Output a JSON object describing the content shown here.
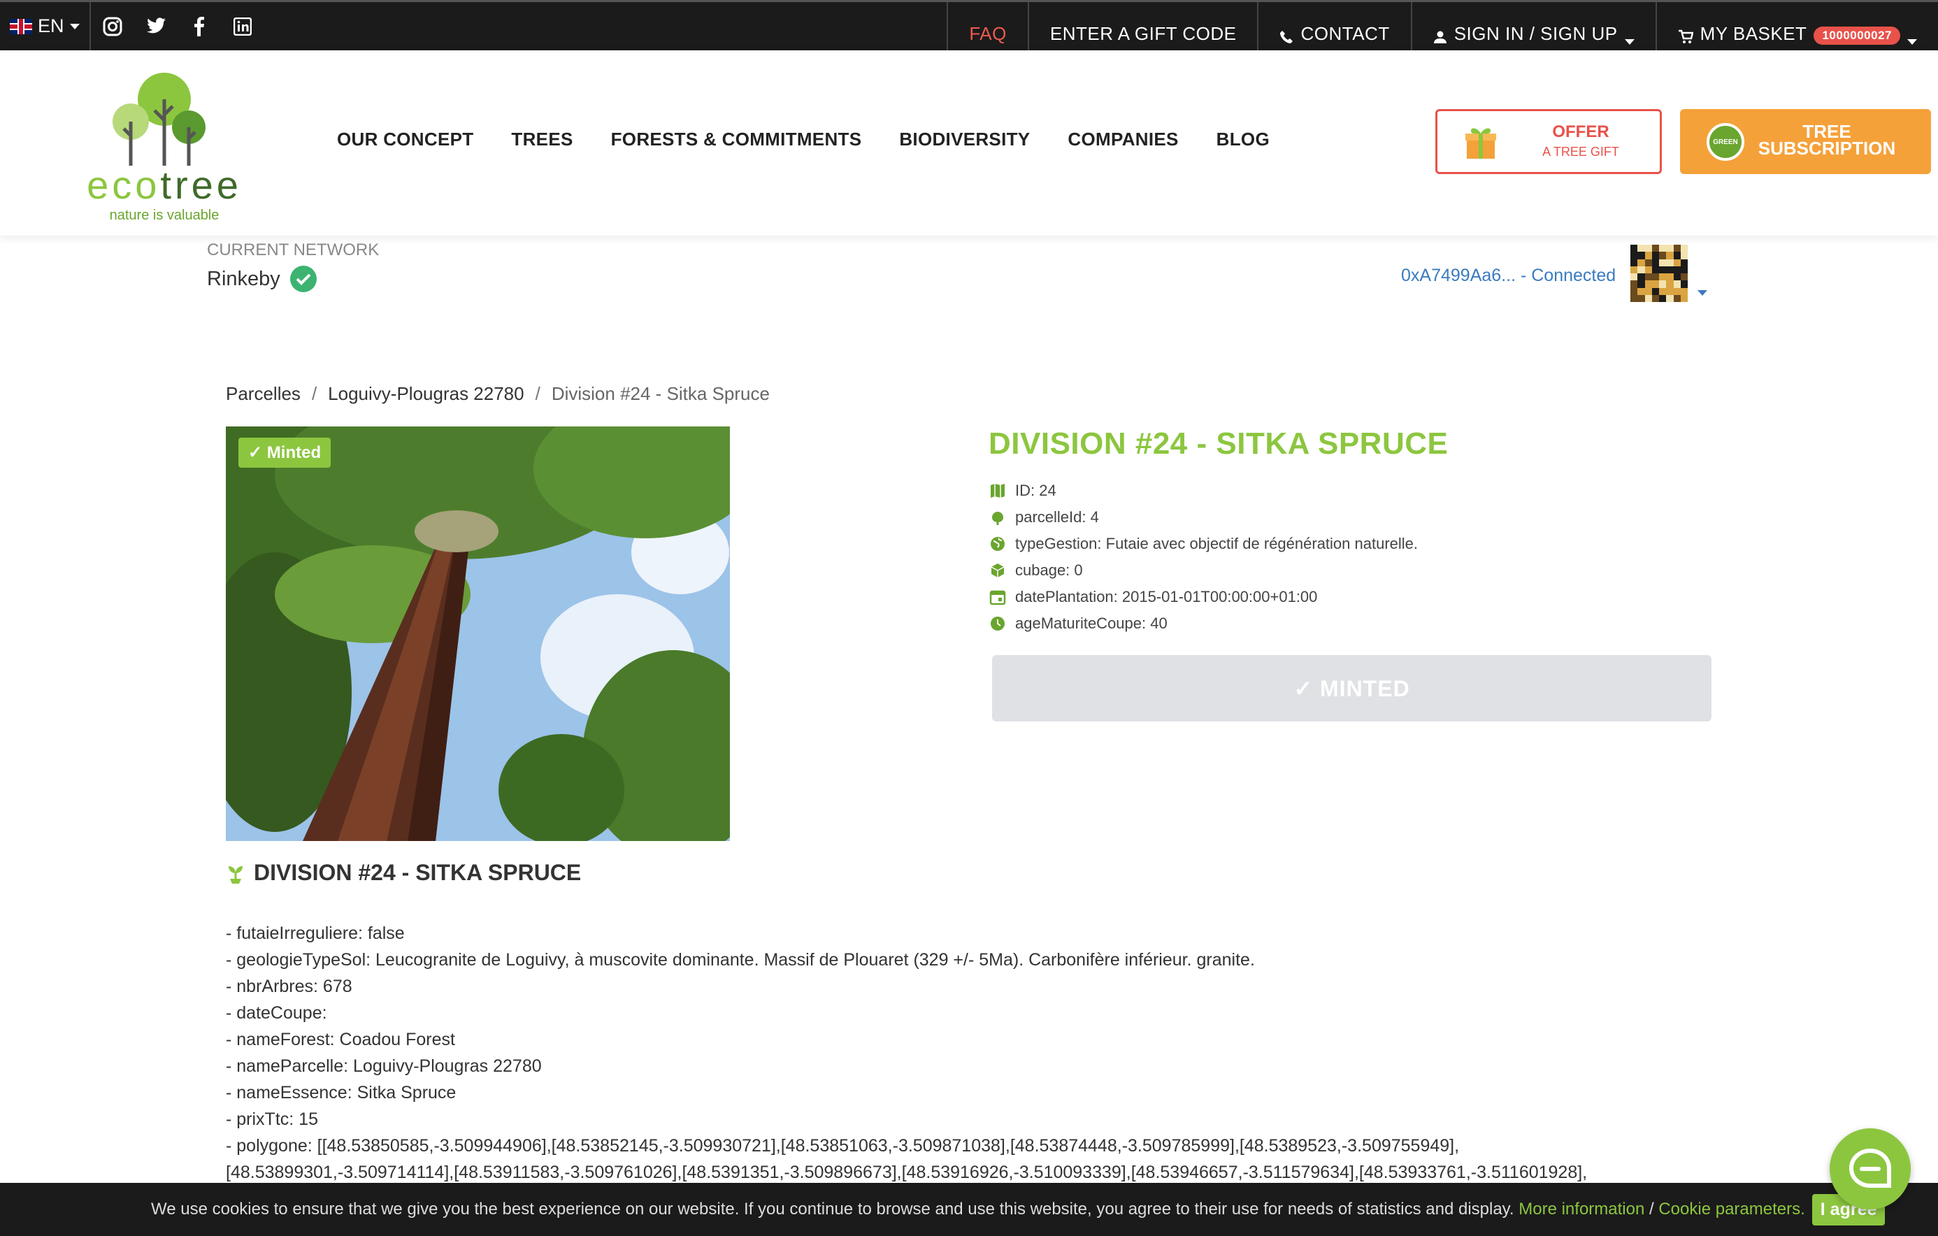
{
  "topbar": {
    "language": "EN",
    "faq": "FAQ",
    "gift_code": "ENTER A GIFT CODE",
    "contact": "CONTACT",
    "sign_in": "SIGN IN / SIGN UP",
    "basket": "MY BASKET",
    "basket_count": "1000000027"
  },
  "logo": {
    "word_light": "eco",
    "word_dark": "tree",
    "tagline": "nature is valuable"
  },
  "nav": {
    "items": [
      "OUR CONCEPT",
      "TREES",
      "FORESTS & COMMITMENTS",
      "BIODIVERSITY",
      "COMPANIES",
      "BLOG"
    ]
  },
  "cta": {
    "offer_line1": "OFFER",
    "offer_line2": "A TREE GIFT",
    "sub_line1": "TREE",
    "sub_line2": "SUBSCRIPTION",
    "sub_badge": "GREEN"
  },
  "network": {
    "label": "CURRENT NETWORK",
    "value": "Rinkeby"
  },
  "wallet": {
    "text": "0xA7499Aa6... - Connected"
  },
  "breadcrumb": [
    "Parcelles",
    "Loguivy-Plougras 22780",
    "Division #24 - Sitka Spruce"
  ],
  "product": {
    "badge": "Minted",
    "title": "DIVISION #24 - SITKA SPRUCE",
    "props": [
      {
        "icon": "map-icon",
        "text": "ID: 24"
      },
      {
        "icon": "leaf-icon",
        "text": "parcelleId: 4"
      },
      {
        "icon": "globe-icon",
        "text": "typeGestion: Futaie avec objectif de régénération naturelle."
      },
      {
        "icon": "cube-icon",
        "text": "cubage: 0"
      },
      {
        "icon": "calendar-icon",
        "text": "datePlantation: 2015-01-01T00:00:00+01:00"
      },
      {
        "icon": "clock-icon",
        "text": "ageMaturiteCoupe: 40"
      }
    ],
    "minted_button": "✓ MINTED",
    "subtitle": "DIVISION #24 - SITKA SPRUCE",
    "description": [
      "- futaieIrreguliere: false",
      "- geologieTypeSol: Leucogranite de Loguivy, à muscovite dominante. Massif de Plouaret (329 +/- 5Ma). Carbonifère inférieur. granite.",
      "- nbrArbres: 678",
      "- dateCoupe:",
      "- nameForest: Coadou Forest",
      "- nameParcelle: Loguivy-Plougras 22780",
      "- nameEssence: Sitka Spruce",
      "- prixTtc: 15",
      "- polygone: [[48.53850585,-3.509944906],[48.53852145,-3.509930721],[48.53851063,-3.509871038],[48.53874448,-3.509785999],[48.5389523,-3.509755949],",
      "[48.53899301,-3.509714114],[48.53911583,-3.509761026],[48.5391351,-3.509896673],[48.53916926,-3.510093339],[48.53946657,-3.511579634],[48.53933761,-3.511601928],"
    ]
  },
  "cookie": {
    "text": "We use cookies to ensure that we give you the best experience on our website. If you continue to browse and use this website, you agree to their use for needs of statistics and display.",
    "more": "More information",
    "slash": "/",
    "params": "Cookie parameters.",
    "agree": "I agree"
  },
  "colors": {
    "brand_green": "#8cc63f",
    "accent_red": "#e8524a",
    "orange": "#f5a13a",
    "link_blue": "#3a7bbf"
  }
}
